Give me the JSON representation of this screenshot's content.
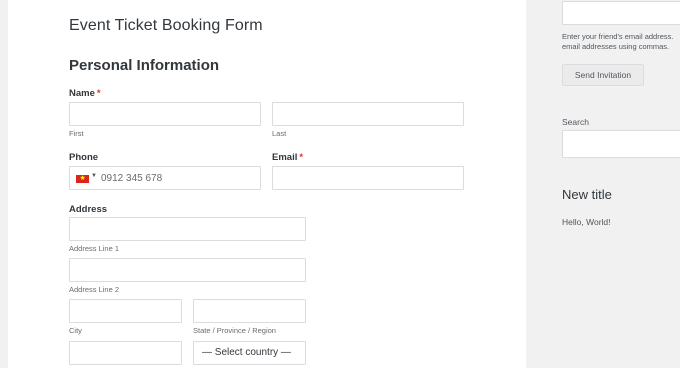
{
  "form": {
    "title": "Event Ticket Booking Form",
    "section_title": "Personal Information",
    "name": {
      "label": "Name",
      "required_mark": "*",
      "first_sublabel": "First",
      "last_sublabel": "Last"
    },
    "phone": {
      "label": "Phone",
      "country_flag": "vietnam-flag-icon",
      "value": "0912 345 678"
    },
    "email": {
      "label": "Email",
      "required_mark": "*"
    },
    "address": {
      "label": "Address",
      "line1_sublabel": "Address Line 1",
      "line2_sublabel": "Address Line 2",
      "city_sublabel": "City",
      "state_sublabel": "State / Province / Region",
      "country_select": "— Select country —"
    }
  },
  "sidebar": {
    "invite_help_line1": "Enter your friend's email address.",
    "invite_help_line2": "email addresses using commas.",
    "send_invitation_label": "Send Invitation",
    "search_label": "Search",
    "widget_title": "New title",
    "widget_body": "Hello, World!"
  }
}
